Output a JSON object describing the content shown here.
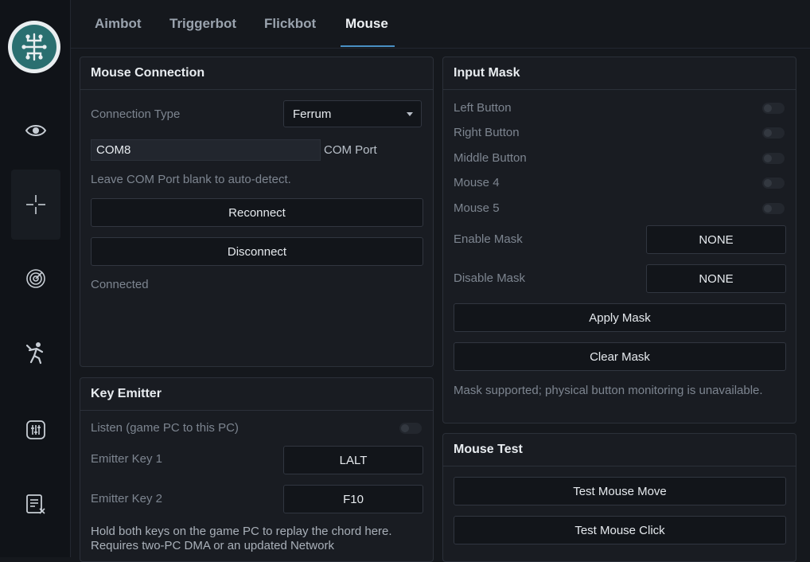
{
  "tabs": [
    "Aimbot",
    "Triggerbot",
    "Flickbot",
    "Mouse"
  ],
  "sidebar": {
    "icons": [
      "logo-icon",
      "eye-icon",
      "crosshair-icon",
      "radar-icon",
      "person-icon",
      "sliders-icon",
      "log-icon"
    ]
  },
  "mouse_connection": {
    "title": "Mouse Connection",
    "connection_type_label": "Connection Type",
    "connection_type_value": "Ferrum",
    "com_port_value": "COM8",
    "com_port_label": "COM Port",
    "hint": "Leave COM Port blank to auto-detect.",
    "reconnect": "Reconnect",
    "disconnect": "Disconnect",
    "status": "Connected"
  },
  "key_emitter": {
    "title": "Key Emitter",
    "listen_label": "Listen (game PC to this PC)",
    "key1_label": "Emitter Key 1",
    "key1_value": "LALT",
    "key2_label": "Emitter Key 2",
    "key2_value": "F10",
    "note": "Hold both keys on the game PC to replay the chord here. Requires two-PC DMA or an updated Network"
  },
  "input_mask": {
    "title": "Input Mask",
    "buttons": [
      "Left Button",
      "Right Button",
      "Middle Button",
      "Mouse 4",
      "Mouse 5"
    ],
    "enable_label": "Enable Mask",
    "enable_value": "NONE",
    "disable_label": "Disable Mask",
    "disable_value": "NONE",
    "apply": "Apply Mask",
    "clear": "Clear Mask",
    "note": "Mask supported; physical button monitoring is unavailable."
  },
  "mouse_test": {
    "title": "Mouse Test",
    "move": "Test Mouse Move",
    "click": "Test Mouse Click"
  },
  "colors": {
    "accent": "#4a90c4",
    "background": "#15181d",
    "panel": "#191c22"
  }
}
